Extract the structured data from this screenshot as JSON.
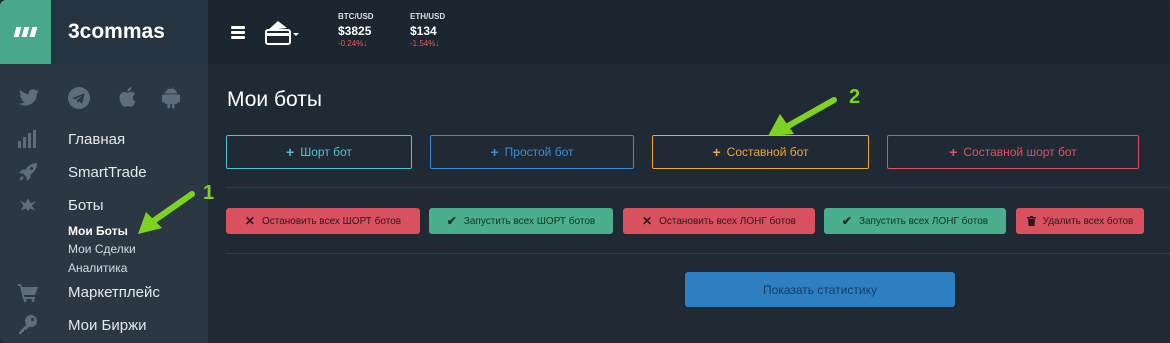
{
  "brand": {
    "name": "3commas"
  },
  "tickers": [
    {
      "pair": "BTC/USD",
      "price": "$3825",
      "change": "-0.24%↓"
    },
    {
      "pair": "ETH/USD",
      "price": "$134",
      "change": "-1.54%↓"
    }
  ],
  "sidebar": {
    "social_icons": [
      "twitter-icon",
      "telegram-icon",
      "apple-icon",
      "android-icon"
    ],
    "items": [
      {
        "label": "Главная",
        "icon": "chart-bars-icon"
      },
      {
        "label": "SmartTrade",
        "icon": "rocket-icon"
      },
      {
        "label": "Боты",
        "icon": "robot-icon"
      },
      {
        "label": "Маркетплейс",
        "icon": "cart-icon"
      },
      {
        "label": "Мои Биржи",
        "icon": "key-icon"
      }
    ],
    "subitems": [
      "Мои Боты",
      "Мои Сделки",
      "Аналитика"
    ]
  },
  "main": {
    "title": "Мои боты",
    "create_buttons": [
      {
        "label": "Шорт бот",
        "color": "#4ec3cf"
      },
      {
        "label": "Простой бот",
        "color": "#3a8fd6"
      },
      {
        "label": "Составной бот",
        "color": "#f0a43a"
      },
      {
        "label": "Составной шорт бот",
        "color": "#e0505e"
      }
    ],
    "action_buttons": [
      {
        "label": "Остановить всех ШОРТ ботов",
        "icon": "x-icon",
        "kind": "red"
      },
      {
        "label": "Запустить всех ШОРТ ботов",
        "icon": "check-icon",
        "kind": "green"
      },
      {
        "label": "Остановить всех ЛОНГ ботов",
        "icon": "x-icon",
        "kind": "red"
      },
      {
        "label": "Запустить всех ЛОНГ ботов",
        "icon": "check-icon",
        "kind": "green"
      },
      {
        "label": "Удалить всех ботов",
        "icon": "trash-icon",
        "kind": "red"
      }
    ],
    "stats_button": "Показать статистику"
  },
  "annotations": [
    "1",
    "2"
  ],
  "colors": {
    "accent_green": "#4aa88a",
    "annotation": "#7ed321"
  }
}
